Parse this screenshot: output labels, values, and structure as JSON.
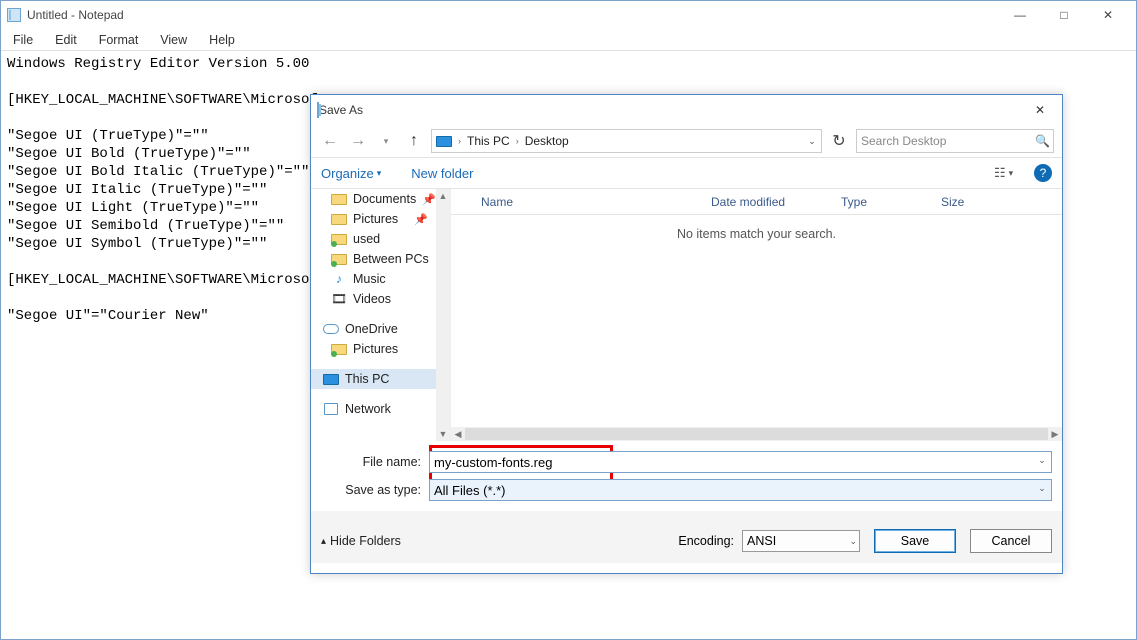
{
  "notepad": {
    "title": "Untitled - Notepad",
    "menu": {
      "file": "File",
      "edit": "Edit",
      "format": "Format",
      "view": "View",
      "help": "Help"
    },
    "text": "Windows Registry Editor Version 5.00\n\n[HKEY_LOCAL_MACHINE\\SOFTWARE\\Microsof\n\n\"Segoe UI (TrueType)\"=\"\"\n\"Segoe UI Bold (TrueType)\"=\"\"\n\"Segoe UI Bold Italic (TrueType)\"=\"\"\n\"Segoe UI Italic (TrueType)\"=\"\"\n\"Segoe UI Light (TrueType)\"=\"\"\n\"Segoe UI Semibold (TrueType)\"=\"\"\n\"Segoe UI Symbol (TrueType)\"=\"\"\n\n[HKEY_LOCAL_MACHINE\\SOFTWARE\\Microsof\n\n\"Segoe UI\"=\"Courier New\""
  },
  "saveas": {
    "title": "Save As",
    "breadcrumb": {
      "root": "This PC",
      "current": "Desktop"
    },
    "search_placeholder": "Search Desktop",
    "toolbar": {
      "organize": "Organize",
      "newfolder": "New folder"
    },
    "columns": {
      "name": "Name",
      "date": "Date modified",
      "type": "Type",
      "size": "Size"
    },
    "empty": "No items match your search.",
    "tree": {
      "documents": "Documents",
      "pictures": "Pictures",
      "used": "used",
      "between": "Between PCs",
      "music": "Music",
      "videos": "Videos",
      "onedrive": "OneDrive",
      "onedrive_pictures": "Pictures",
      "thispc": "This PC",
      "network": "Network"
    },
    "labels": {
      "filename": "File name:",
      "saveastype": "Save as type:",
      "encoding": "Encoding:",
      "hidefolders": "Hide Folders"
    },
    "values": {
      "filename": "my-custom-fonts.reg",
      "saveastype": "All Files  (*.*)",
      "encoding": "ANSI"
    },
    "buttons": {
      "save": "Save",
      "cancel": "Cancel"
    }
  }
}
